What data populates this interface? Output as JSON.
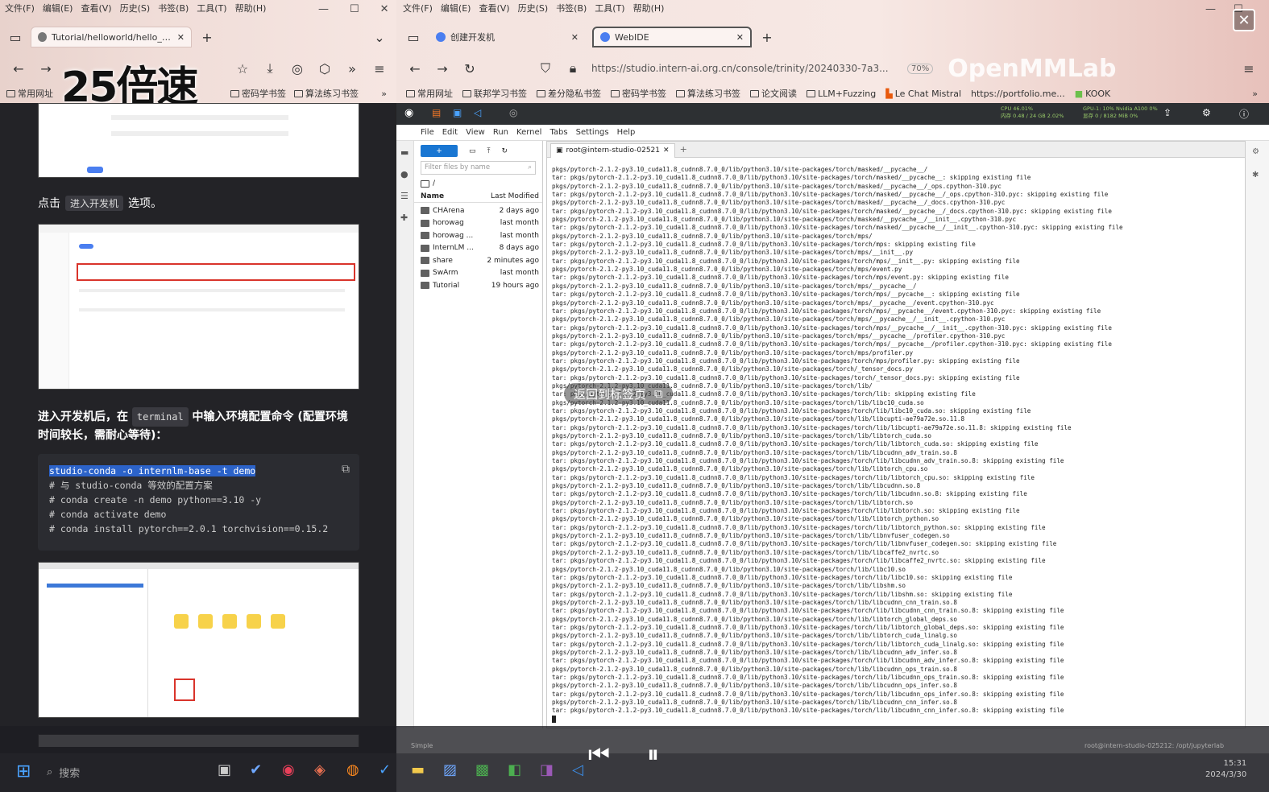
{
  "speed_badge": "25倍速",
  "left_browser": {
    "menu": [
      "文件(F)",
      "编辑(E)",
      "查看(V)",
      "历史(S)",
      "书签(B)",
      "工具(T)",
      "帮助(H)"
    ],
    "tab_label": "Tutorial/helloworld/hello_wo...",
    "bookmarks": [
      "常用网址",
      "密码学书签",
      "算法练习书签"
    ],
    "doc": {
      "p1_prefix": "点击",
      "p1_key": "进入开发机",
      "p1_suffix": "选项。",
      "p2_a": "进入开发机后，在",
      "p2_key": "terminal",
      "p2_b": "中输入环境配置命令 (配置环境",
      "p2_c": "时间较长，需耐心等待)：",
      "code": [
        "studio-conda -o internlm-base -t demo",
        "# 与 studio-conda 等效的配置方案",
        "# conda create -n demo python==3.10 -y",
        "# conda activate demo",
        "# conda install pytorch==2.0.1 torchvision==0.15.2"
      ]
    }
  },
  "right_browser": {
    "menu": [
      "文件(F)",
      "编辑(E)",
      "查看(V)",
      "历史(S)",
      "书签(B)",
      "工具(T)",
      "帮助(H)"
    ],
    "tabs": [
      "创建开发机",
      "WebIDE"
    ],
    "url": "https://studio.intern-ai.org.cn/console/trinity/20240330-7a3...",
    "zoom": "70%",
    "bookmarks": [
      "常用网址",
      "联邦学习书签",
      "差分隐私书签",
      "密码学书签",
      "算法练习书签",
      "论文阅读",
      "LLM+Fuzzing",
      "Le Chat Mistral",
      "https://portfolio.me...",
      "KOOK"
    ],
    "watermark": "OpenMMLab",
    "jupyter_status": {
      "cpu": "CPU 46.01%",
      "mem": "内存 0.48 / 24 GB 2.02%",
      "gpu": "GPU-1: 10% Nvidia A100 0%",
      "vram": "显存 0 / 8182 MiB 0%"
    },
    "jupyter_menu": [
      "File",
      "Edit",
      "View",
      "Run",
      "Kernel",
      "Tabs",
      "Settings",
      "Help"
    ],
    "filter_placeholder": "Filter files by name",
    "path": "/",
    "col_name": "Name",
    "col_modified": "Last Modified",
    "files": [
      {
        "name": "CHArena",
        "modified": "2 days ago"
      },
      {
        "name": "horowag",
        "modified": "last month"
      },
      {
        "name": "horowag ...",
        "modified": "last month"
      },
      {
        "name": "InternLM ...",
        "modified": "8 days ago"
      },
      {
        "name": "share",
        "modified": "2 minutes ago"
      },
      {
        "name": "SwArm",
        "modified": "last month"
      },
      {
        "name": "Tutorial",
        "modified": "19 hours ago"
      }
    ],
    "terminal_tab": "root@intern-studio-02521",
    "status_left": "Simple",
    "status_right": "root@intern-studio-025212: /opt/jupyterlab"
  },
  "terminal_lines": [
    "pkgs/pytorch-2.1.2-py3.10_cuda11.8_cudnn8.7.0_0/lib/python3.10/site-packages/torch/masked/__pycache__/",
    "tar: pkgs/pytorch-2.1.2-py3.10_cuda11.8_cudnn8.7.0_0/lib/python3.10/site-packages/torch/masked/__pycache__: skipping existing file",
    "pkgs/pytorch-2.1.2-py3.10_cuda11.8_cudnn8.7.0_0/lib/python3.10/site-packages/torch/masked/__pycache__/_ops.cpython-310.pyc",
    "tar: pkgs/pytorch-2.1.2-py3.10_cuda11.8_cudnn8.7.0_0/lib/python3.10/site-packages/torch/masked/__pycache__/_ops.cpython-310.pyc: skipping existing file",
    "pkgs/pytorch-2.1.2-py3.10_cuda11.8_cudnn8.7.0_0/lib/python3.10/site-packages/torch/masked/__pycache__/_docs.cpython-310.pyc",
    "tar: pkgs/pytorch-2.1.2-py3.10_cuda11.8_cudnn8.7.0_0/lib/python3.10/site-packages/torch/masked/__pycache__/_docs.cpython-310.pyc: skipping existing file",
    "pkgs/pytorch-2.1.2-py3.10_cuda11.8_cudnn8.7.0_0/lib/python3.10/site-packages/torch/masked/__pycache__/__init__.cpython-310.pyc",
    "tar: pkgs/pytorch-2.1.2-py3.10_cuda11.8_cudnn8.7.0_0/lib/python3.10/site-packages/torch/masked/__pycache__/__init__.cpython-310.pyc: skipping existing file",
    "pkgs/pytorch-2.1.2-py3.10_cuda11.8_cudnn8.7.0_0/lib/python3.10/site-packages/torch/mps/",
    "tar: pkgs/pytorch-2.1.2-py3.10_cuda11.8_cudnn8.7.0_0/lib/python3.10/site-packages/torch/mps: skipping existing file",
    "pkgs/pytorch-2.1.2-py3.10_cuda11.8_cudnn8.7.0_0/lib/python3.10/site-packages/torch/mps/__init__.py",
    "tar: pkgs/pytorch-2.1.2-py3.10_cuda11.8_cudnn8.7.0_0/lib/python3.10/site-packages/torch/mps/__init__.py: skipping existing file",
    "pkgs/pytorch-2.1.2-py3.10_cuda11.8_cudnn8.7.0_0/lib/python3.10/site-packages/torch/mps/event.py",
    "tar: pkgs/pytorch-2.1.2-py3.10_cuda11.8_cudnn8.7.0_0/lib/python3.10/site-packages/torch/mps/event.py: skipping existing file",
    "pkgs/pytorch-2.1.2-py3.10_cuda11.8_cudnn8.7.0_0/lib/python3.10/site-packages/torch/mps/__pycache__/",
    "tar: pkgs/pytorch-2.1.2-py3.10_cuda11.8_cudnn8.7.0_0/lib/python3.10/site-packages/torch/mps/__pycache__: skipping existing file",
    "pkgs/pytorch-2.1.2-py3.10_cuda11.8_cudnn8.7.0_0/lib/python3.10/site-packages/torch/mps/__pycache__/event.cpython-310.pyc",
    "tar: pkgs/pytorch-2.1.2-py3.10_cuda11.8_cudnn8.7.0_0/lib/python3.10/site-packages/torch/mps/__pycache__/event.cpython-310.pyc: skipping existing file",
    "pkgs/pytorch-2.1.2-py3.10_cuda11.8_cudnn8.7.0_0/lib/python3.10/site-packages/torch/mps/__pycache__/__init__.cpython-310.pyc",
    "tar: pkgs/pytorch-2.1.2-py3.10_cuda11.8_cudnn8.7.0_0/lib/python3.10/site-packages/torch/mps/__pycache__/__init__.cpython-310.pyc: skipping existing file",
    "pkgs/pytorch-2.1.2-py3.10_cuda11.8_cudnn8.7.0_0/lib/python3.10/site-packages/torch/mps/__pycache__/profiler.cpython-310.pyc",
    "tar: pkgs/pytorch-2.1.2-py3.10_cuda11.8_cudnn8.7.0_0/lib/python3.10/site-packages/torch/mps/__pycache__/profiler.cpython-310.pyc: skipping existing file",
    "pkgs/pytorch-2.1.2-py3.10_cuda11.8_cudnn8.7.0_0/lib/python3.10/site-packages/torch/mps/profiler.py",
    "tar: pkgs/pytorch-2.1.2-py3.10_cuda11.8_cudnn8.7.0_0/lib/python3.10/site-packages/torch/mps/profiler.py: skipping existing file",
    "pkgs/pytorch-2.1.2-py3.10_cuda11.8_cudnn8.7.0_0/lib/python3.10/site-packages/torch/_tensor_docs.py",
    "tar: pkgs/pytorch-2.1.2-py3.10_cuda11.8_cudnn8.7.0_0/lib/python3.10/site-packages/torch/_tensor_docs.py: skipping existing file",
    "pkgs/pytorch-2.1.2-py3.10_cuda11.8_cudnn8.7.0_0/lib/python3.10/site-packages/torch/lib/",
    "tar: pkgs/pytorch-2.1.2-py3.10_cuda11.8_cudnn8.7.0_0/lib/python3.10/site-packages/torch/lib: skipping existing file",
    "pkgs/pytorch-2.1.2-py3.10_cuda11.8_cudnn8.7.0_0/lib/python3.10/site-packages/torch/lib/libc10_cuda.so",
    "tar: pkgs/pytorch-2.1.2-py3.10_cuda11.8_cudnn8.7.0_0/lib/python3.10/site-packages/torch/lib/libc10_cuda.so: skipping existing file",
    "pkgs/pytorch-2.1.2-py3.10_cuda11.8_cudnn8.7.0_0/lib/python3.10/site-packages/torch/lib/libcupti-ae79a72e.so.11.8",
    "tar: pkgs/pytorch-2.1.2-py3.10_cuda11.8_cudnn8.7.0_0/lib/python3.10/site-packages/torch/lib/libcupti-ae79a72e.so.11.8: skipping existing file",
    "pkgs/pytorch-2.1.2-py3.10_cuda11.8_cudnn8.7.0_0/lib/python3.10/site-packages/torch/lib/libtorch_cuda.so",
    "tar: pkgs/pytorch-2.1.2-py3.10_cuda11.8_cudnn8.7.0_0/lib/python3.10/site-packages/torch/lib/libtorch_cuda.so: skipping existing file",
    "pkgs/pytorch-2.1.2-py3.10_cuda11.8_cudnn8.7.0_0/lib/python3.10/site-packages/torch/lib/libcudnn_adv_train.so.8",
    "tar: pkgs/pytorch-2.1.2-py3.10_cuda11.8_cudnn8.7.0_0/lib/python3.10/site-packages/torch/lib/libcudnn_adv_train.so.8: skipping existing file",
    "pkgs/pytorch-2.1.2-py3.10_cuda11.8_cudnn8.7.0_0/lib/python3.10/site-packages/torch/lib/libtorch_cpu.so",
    "tar: pkgs/pytorch-2.1.2-py3.10_cuda11.8_cudnn8.7.0_0/lib/python3.10/site-packages/torch/lib/libtorch_cpu.so: skipping existing file",
    "pkgs/pytorch-2.1.2-py3.10_cuda11.8_cudnn8.7.0_0/lib/python3.10/site-packages/torch/lib/libcudnn.so.8",
    "tar: pkgs/pytorch-2.1.2-py3.10_cuda11.8_cudnn8.7.0_0/lib/python3.10/site-packages/torch/lib/libcudnn.so.8: skipping existing file",
    "pkgs/pytorch-2.1.2-py3.10_cuda11.8_cudnn8.7.0_0/lib/python3.10/site-packages/torch/lib/libtorch.so",
    "tar: pkgs/pytorch-2.1.2-py3.10_cuda11.8_cudnn8.7.0_0/lib/python3.10/site-packages/torch/lib/libtorch.so: skipping existing file",
    "pkgs/pytorch-2.1.2-py3.10_cuda11.8_cudnn8.7.0_0/lib/python3.10/site-packages/torch/lib/libtorch_python.so",
    "tar: pkgs/pytorch-2.1.2-py3.10_cuda11.8_cudnn8.7.0_0/lib/python3.10/site-packages/torch/lib/libtorch_python.so: skipping existing file",
    "pkgs/pytorch-2.1.2-py3.10_cuda11.8_cudnn8.7.0_0/lib/python3.10/site-packages/torch/lib/libnvfuser_codegen.so",
    "tar: pkgs/pytorch-2.1.2-py3.10_cuda11.8_cudnn8.7.0_0/lib/python3.10/site-packages/torch/lib/libnvfuser_codegen.so: skipping existing file",
    "pkgs/pytorch-2.1.2-py3.10_cuda11.8_cudnn8.7.0_0/lib/python3.10/site-packages/torch/lib/libcaffe2_nvrtc.so",
    "tar: pkgs/pytorch-2.1.2-py3.10_cuda11.8_cudnn8.7.0_0/lib/python3.10/site-packages/torch/lib/libcaffe2_nvrtc.so: skipping existing file",
    "pkgs/pytorch-2.1.2-py3.10_cuda11.8_cudnn8.7.0_0/lib/python3.10/site-packages/torch/lib/libc10.so",
    "tar: pkgs/pytorch-2.1.2-py3.10_cuda11.8_cudnn8.7.0_0/lib/python3.10/site-packages/torch/lib/libc10.so: skipping existing file",
    "pkgs/pytorch-2.1.2-py3.10_cuda11.8_cudnn8.7.0_0/lib/python3.10/site-packages/torch/lib/libshm.so",
    "tar: pkgs/pytorch-2.1.2-py3.10_cuda11.8_cudnn8.7.0_0/lib/python3.10/site-packages/torch/lib/libshm.so: skipping existing file",
    "pkgs/pytorch-2.1.2-py3.10_cuda11.8_cudnn8.7.0_0/lib/python3.10/site-packages/torch/lib/libcudnn_cnn_train.so.8",
    "tar: pkgs/pytorch-2.1.2-py3.10_cuda11.8_cudnn8.7.0_0/lib/python3.10/site-packages/torch/lib/libcudnn_cnn_train.so.8: skipping existing file",
    "pkgs/pytorch-2.1.2-py3.10_cuda11.8_cudnn8.7.0_0/lib/python3.10/site-packages/torch/lib/libtorch_global_deps.so",
    "tar: pkgs/pytorch-2.1.2-py3.10_cuda11.8_cudnn8.7.0_0/lib/python3.10/site-packages/torch/lib/libtorch_global_deps.so: skipping existing file",
    "pkgs/pytorch-2.1.2-py3.10_cuda11.8_cudnn8.7.0_0/lib/python3.10/site-packages/torch/lib/libtorch_cuda_linalg.so",
    "tar: pkgs/pytorch-2.1.2-py3.10_cuda11.8_cudnn8.7.0_0/lib/python3.10/site-packages/torch/lib/libtorch_cuda_linalg.so: skipping existing file",
    "pkgs/pytorch-2.1.2-py3.10_cuda11.8_cudnn8.7.0_0/lib/python3.10/site-packages/torch/lib/libcudnn_adv_infer.so.8",
    "tar: pkgs/pytorch-2.1.2-py3.10_cuda11.8_cudnn8.7.0_0/lib/python3.10/site-packages/torch/lib/libcudnn_adv_infer.so.8: skipping existing file",
    "pkgs/pytorch-2.1.2-py3.10_cuda11.8_cudnn8.7.0_0/lib/python3.10/site-packages/torch/lib/libcudnn_ops_train.so.8",
    "tar: pkgs/pytorch-2.1.2-py3.10_cuda11.8_cudnn8.7.0_0/lib/python3.10/site-packages/torch/lib/libcudnn_ops_train.so.8: skipping existing file",
    "pkgs/pytorch-2.1.2-py3.10_cuda11.8_cudnn8.7.0_0/lib/python3.10/site-packages/torch/lib/libcudnn_ops_infer.so.8",
    "tar: pkgs/pytorch-2.1.2-py3.10_cuda11.8_cudnn8.7.0_0/lib/python3.10/site-packages/torch/lib/libcudnn_ops_infer.so.8: skipping existing file",
    "pkgs/pytorch-2.1.2-py3.10_cuda11.8_cudnn8.7.0_0/lib/python3.10/site-packages/torch/lib/libcudnn_cnn_infer.so.8",
    "tar: pkgs/pytorch-2.1.2-py3.10_cuda11.8_cudnn8.7.0_0/lib/python3.10/site-packages/torch/lib/libcudnn_cnn_infer.so.8: skipping existing file"
  ],
  "overlay": {
    "return_pill": "返回到标签页",
    "clock_time": "15:31",
    "clock_date": "2024/3/30",
    "search": "搜索"
  }
}
